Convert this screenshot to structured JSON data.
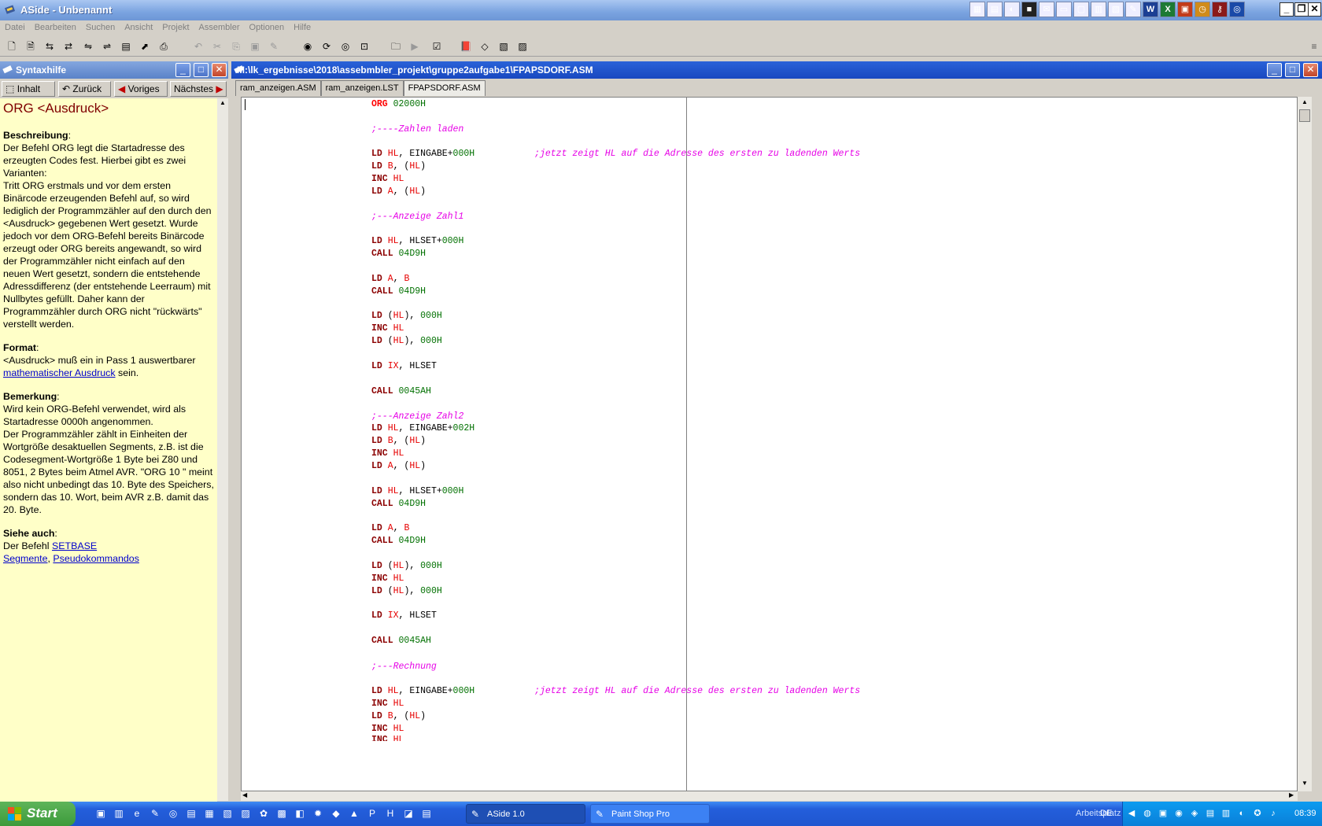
{
  "window": {
    "title": "ASide - Unbenannt"
  },
  "menu": [
    "Datei",
    "Bearbeiten",
    "Suchen",
    "Ansicht",
    "Projekt",
    "Assembler",
    "Optionen",
    "Hilfe"
  ],
  "help_panel": {
    "title": "Syntaxhilfe",
    "nav": {
      "contents": "Inhalt",
      "back": "Zurück",
      "prev": "Voriges",
      "next": "Nächstes"
    },
    "heading": "ORG <Ausdruck>",
    "sections": {
      "desc_label": "Beschreibung",
      "desc_1": "Der Befehl ORG legt die Startadresse des erzeugten Codes fest. Hierbei gibt es zwei Varianten:",
      "desc_2": "Tritt ORG erstmals und vor dem ersten Binärcode erzeugenden Befehl auf, so wird lediglich der Programmzähler auf den durch den <Ausdruck> gegebenen Wert gesetzt. Wurde jedoch vor dem ORG-Befehl bereits Binärcode erzeugt oder ORG bereits angewandt, so wird der Programmzähler nicht einfach auf den neuen Wert gesetzt, sondern die entstehende Adressdifferenz (der entstehende Leerraum) mit Nullbytes gefüllt. Daher kann der Programmzähler durch ORG nicht \"rückwärts\" verstellt werden.",
      "format_label": "Format",
      "format_text": "<Ausdruck> muß ein in Pass 1 auswertbarer",
      "format_link": "mathematischer Ausdruck",
      "format_tail": " sein.",
      "remark_label": "Bemerkung",
      "remark_1": "Wird kein ORG-Befehl verwendet, wird als Startadresse 0000h angenommen.",
      "remark_2": "Der Programmzähler zählt in Einheiten der Wortgröße desaktuellen Segments, z.B. ist die Codesegment-Wortgröße 1 Byte bei Z80 und 8051, 2 Bytes beim Atmel AVR. \"ORG 10 \" meint also nicht unbedingt das 10. Byte des Speichers, sondern das 10. Wort, beim AVR z.B. damit das 20. Byte.",
      "see_label": "Siehe auch",
      "see_prefix": "Der Befehl ",
      "see_link1": "SETBASE",
      "see_link2": "Segmente",
      "see_link3": "Pseudokommandos"
    }
  },
  "editor": {
    "title": "M:\\lk_ergebnisse\\2018\\assebmbler_projekt\\gruppe2aufgabe1\\FPAPSDORF.ASM",
    "tabs": [
      "ram_anzeigen.ASM",
      "ram_anzeigen.LST",
      "FPAPSDORF.ASM"
    ],
    "active_tab": 2
  },
  "taskbar": {
    "start": "Start",
    "tasks": [
      "ASide 1.0",
      "Paint Shop Pro"
    ],
    "lang": "DE",
    "arbeitsplatz": "Arbeitsplatz",
    "clock": "08:39"
  }
}
